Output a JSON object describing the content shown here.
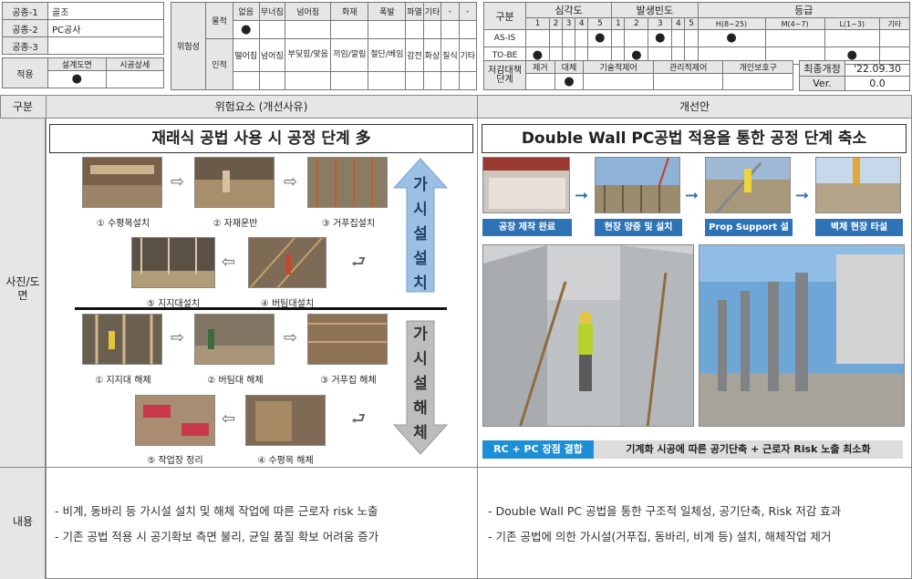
{
  "trade": {
    "rows": [
      {
        "label": "공종-1",
        "value": "골조"
      },
      {
        "label": "공종-2",
        "value": "PC공사"
      },
      {
        "label": "공종-3",
        "value": ""
      }
    ],
    "apply_label": "적용",
    "design_label": "설계도면",
    "const_label": "시공상세",
    "mark": "●"
  },
  "risk": {
    "label": "위험성",
    "physical": "물적",
    "human": "인적",
    "phys_items": [
      "없음",
      "무너짐",
      "넘어짐",
      "화재",
      "폭발",
      "파열",
      "기타",
      "-",
      "-"
    ],
    "human_items": [
      "떨어짐",
      "넘어짐",
      "부딪힘/맞음",
      "끼임/깔림",
      "절단/베임",
      "감전",
      "화상",
      "질식",
      "기타"
    ]
  },
  "eval": {
    "div": "구분",
    "severity": "심각도",
    "frequency": "발생빈도",
    "grade": "등급",
    "nums": [
      "1",
      "2",
      "3",
      "4",
      "5",
      "1",
      "2",
      "3",
      "4",
      "5"
    ],
    "grades": [
      "H(8~25)",
      "M(4~7)",
      "L(1~3)",
      "기타"
    ],
    "asis": "AS-IS",
    "tobe": "TO-BE"
  },
  "reduce": {
    "label": "저감대책단계",
    "items": [
      "제거",
      "대체",
      "기술적제어",
      "관리적제어",
      "개인보호구"
    ],
    "final_label": "최종개정",
    "final_value": "'22.09.30",
    "ver_label": "Ver.",
    "ver_value": "0.0"
  },
  "main": {
    "div": "구분",
    "risk_col": "위험요소 (개선사유)",
    "improve_col": "개선안",
    "photo_label": "사진/도면",
    "content_label": "내용"
  },
  "left": {
    "title": "재래식 공법 사용 시 공정 단계 多",
    "install_caps": [
      "① 수평목설치",
      "② 자재운반",
      "③ 거푸집설치",
      "④ 버팀대설치",
      "⑤ 지지대설치"
    ],
    "remove_caps": [
      "① 지지대 해체",
      "② 버팀대 해체",
      "③ 거푸집 해체",
      "④ 수평목 해체",
      "⑤ 작업장 정리"
    ],
    "install_arrow": "가시설설치",
    "remove_arrow": "가시설해체"
  },
  "right": {
    "title": "Double Wall PC공법 적용을 통한 공정 단계 축소",
    "steps": [
      "공장 제작 완료",
      "현장 양중 및 설치",
      "Prop Support 설치",
      "벽체 현장 타설"
    ],
    "tag": "RC + PC 장점 결합",
    "tag_text": "기계화 시공에 따른 공기단축 + 근로자 Risk 노출 최소화"
  },
  "content": {
    "left": [
      "-  비계, 동바리 등 가시설 설치 및 해체 작업에 따른 근로자 risk 노출",
      "-  기존 공법 적용 시 공기확보 측면 불리, 균일 품질 확보 어려움 증가"
    ],
    "right": [
      "- Double Wall PC 공법을 통한 구조적 일체성, 공기단축, Risk 저감 효과",
      "-  기존 공법에 의한 가시설(거푸집, 동바리, 비계 등) 설치, 해체작업 제거"
    ]
  },
  "colors": {
    "accent": "#2f73b7",
    "tag": "#1e8fd6",
    "up_arrow": "#9cc0e4",
    "down_arrow": "#bdbdbd"
  }
}
